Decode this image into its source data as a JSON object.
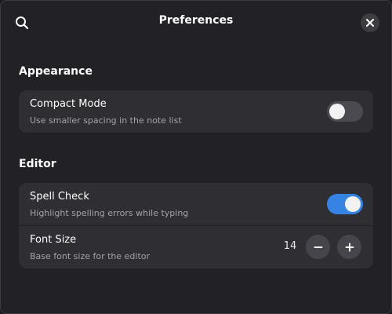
{
  "header": {
    "title": "Preferences",
    "search_icon": "search-icon",
    "close_icon": "close-icon"
  },
  "sections": [
    {
      "heading": "Appearance",
      "rows": [
        {
          "title": "Compact Mode",
          "subtitle": "Use smaller spacing in the note list",
          "control": "switch",
          "enabled": false
        }
      ]
    },
    {
      "heading": "Editor",
      "rows": [
        {
          "title": "Spell Check",
          "subtitle": "Highlight spelling errors while typing",
          "control": "switch",
          "enabled": true
        },
        {
          "title": "Font Size",
          "subtitle": "Base font size for the editor",
          "control": "spin",
          "value": "14",
          "decrement_icon": "minus-icon",
          "increment_icon": "plus-icon"
        }
      ]
    }
  ],
  "colors": {
    "window_bg": "#222226",
    "card_bg": "#2e2e33",
    "accent": "#3584e4",
    "switch_off": "#4a4a50"
  }
}
